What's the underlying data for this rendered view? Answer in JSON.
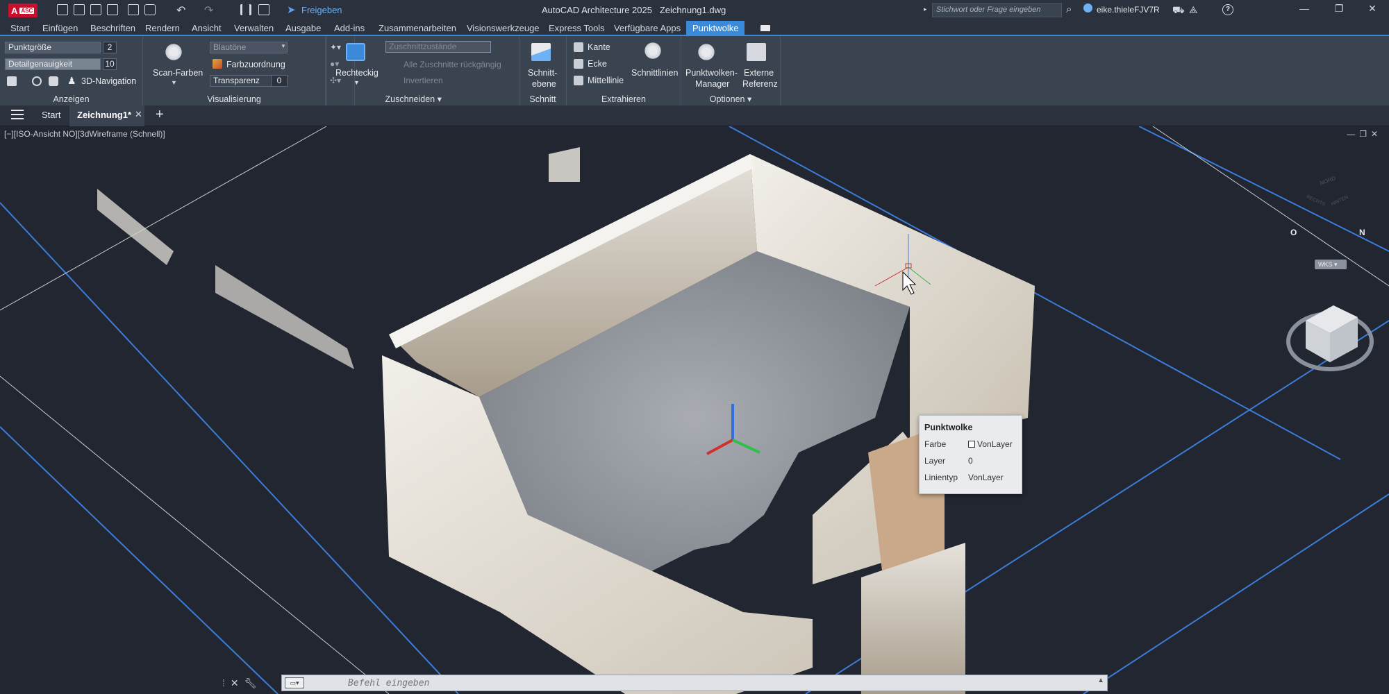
{
  "titlebar": {
    "app_badge": "A",
    "app_badge_sub": "ASC",
    "share_label": "Freigeben",
    "app_title": "AutoCAD Architecture 2025",
    "file_name": "Zeichnung1.dwg",
    "search_placeholder": "Stichwort oder Frage eingeben",
    "user_name": "eike.thieleFJV7R"
  },
  "menu_tabs": [
    "Start",
    "Einfügen",
    "Beschriften",
    "Rendern",
    "Ansicht",
    "Verwalten",
    "Ausgabe",
    "Add-ins",
    "Zusammenarbeiten",
    "Visionswerkzeuge",
    "Express Tools",
    "Verfügbare Apps",
    "Punktwolke"
  ],
  "active_tab": "Punktwolke",
  "ribbon": {
    "anzeigen": {
      "title": "Anzeigen",
      "punktgroesse_label": "Punktgröße",
      "punktgroesse_value": "2",
      "detailgenauigkeit_label": "Detailgenauigkeit",
      "detailgenauigkeit_value": "10",
      "nav3d_label": "3D-Navigation"
    },
    "visualisierung": {
      "title": "Visualisierung",
      "scan_farben_label": "Scan-Farben",
      "color_scheme_value": "Blautöne",
      "farbzuordnung_label": "Farbzuordnung",
      "transparenz_label": "Transparenz",
      "transparenz_value": "0"
    },
    "zuschneiden": {
      "title": "Zuschneiden",
      "rechteckig_label": "Rechteckig",
      "zustaende_label": "Zuschnittzustände",
      "reset_label": "Alle Zuschnitte rückgängig",
      "invertieren_label": "Invertieren"
    },
    "schnitt": {
      "title": "Schnitt",
      "schnittebene_label_1": "Schnitt-",
      "schnittebene_label_2": "ebene"
    },
    "extrahieren": {
      "title": "Extrahieren",
      "kante_label": "Kante",
      "ecke_label": "Ecke",
      "mittellinie_label": "Mittellinie",
      "schnittlinien_label": "Schnittlinien"
    },
    "optionen": {
      "title": "Optionen",
      "manager_label_1": "Punktwolken-",
      "manager_label_2": "Manager",
      "extern_label_1": "Externe",
      "extern_label_2": "Referenz"
    }
  },
  "doc_tabs": {
    "start": "Start",
    "current": "Zeichnung1*"
  },
  "viewport": {
    "label": "[−][ISO-Ansicht NO][3dWireframe (Schnell)]",
    "viewcube_top": "NORD",
    "viewcube_left": "RECHTS",
    "viewcube_right": "HINTEN",
    "compass_n": "N",
    "compass_o": "O",
    "wks_label": "WKS",
    "colors": {
      "background": "#212630",
      "grid_blue": "#3b7dd8",
      "grid_grey": "#c9ced6",
      "axis_x": "#d0312d",
      "axis_y": "#2fbf4a",
      "axis_z": "#2f6fe0"
    }
  },
  "tooltip": {
    "title": "Punktwolke",
    "rows": [
      {
        "label": "Farbe",
        "value": "VonLayer"
      },
      {
        "label": "Layer",
        "value": "0"
      },
      {
        "label": "Linientyp",
        "value": "VonLayer"
      }
    ]
  },
  "command": {
    "placeholder": "Befehl eingeben"
  }
}
